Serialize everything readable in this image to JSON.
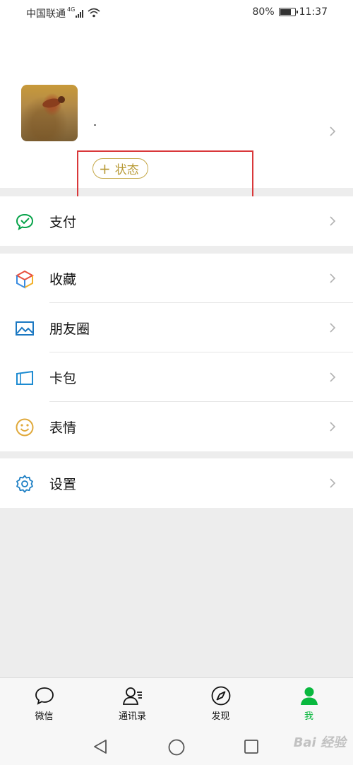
{
  "status_bar": {
    "carrier": "中国联通",
    "network": "4G",
    "battery": "80%",
    "battery_level": 0.8,
    "time": "11:37"
  },
  "profile": {
    "name": ".",
    "status_button": "状态",
    "status_plus": "+"
  },
  "menu": {
    "pay": "支付",
    "favorites": "收藏",
    "moments": "朋友圈",
    "cards": "卡包",
    "stickers": "表情",
    "settings": "设置"
  },
  "tabs": {
    "chats": "微信",
    "contacts": "通讯录",
    "discover": "发现",
    "me": "我"
  },
  "watermark": "Bai 经验",
  "colors": {
    "accent": "#09b83e",
    "status_button": "#c6a94a",
    "highlight": "#d9383a",
    "background": "#ededed"
  },
  "icons": {
    "pay": "pay-icon",
    "favorites": "cube-icon",
    "moments": "picture-icon",
    "cards": "wallet-card-icon",
    "stickers": "smiley-icon",
    "settings": "gear-icon"
  }
}
